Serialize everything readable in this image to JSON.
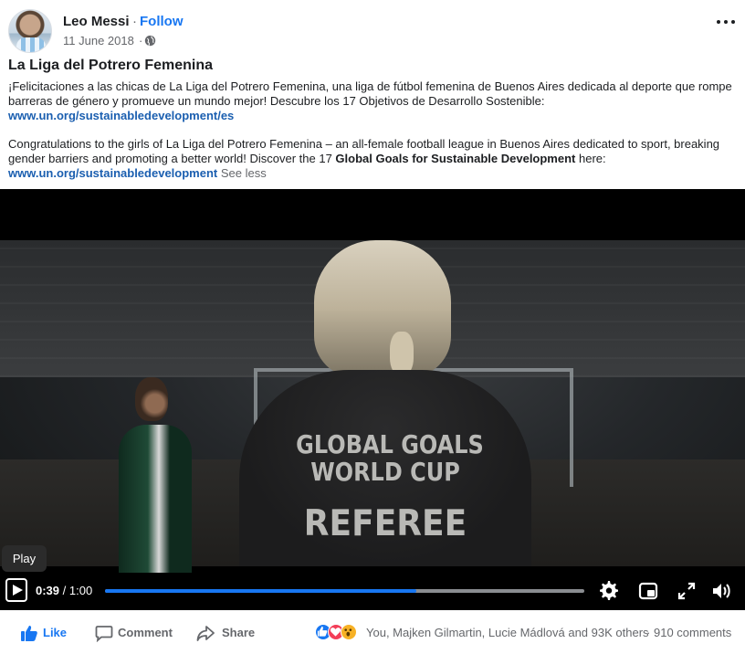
{
  "post": {
    "author": "Leo Messi",
    "separator": "·",
    "follow_label": "Follow",
    "date": "11 June 2018",
    "date_separator": "·",
    "privacy_icon": "globe-icon",
    "more_icon": "more-horizontal-icon",
    "title": "La Liga del Potrero Femenina",
    "para_es_text": "¡Felicitaciones a las chicas de La Liga del Potrero Femenina, una liga de fútbol femenina de Buenos Aires dedicada al deporte que rompe barreras de género y promueve un mundo mejor! Descubre los 17 Objetivos de Desarrollo Sostenible:",
    "para_es_link": "www.un.org/sustainabledevelopment/es",
    "para_en_text_1": "Congratulations to the girls of La Liga del Potrero Femenina – an all-female football league in Buenos Aires dedicated to sport, breaking gender barriers and promoting a better world! Discover the 17 ",
    "para_en_bold": "Global Goals for Sustainable Development",
    "para_en_text_2": " here:",
    "para_en_link": "www.un.org/sustainabledevelopment",
    "see_less": "See less"
  },
  "video": {
    "shirt_line_1": "GLOBAL GOALS",
    "shirt_line_2": "WORLD CUP",
    "shirt_line_3": "REFEREE",
    "tooltip": "Play",
    "current_time": "0:39",
    "time_separator": "/",
    "duration": "1:00",
    "progress_fraction": 0.65,
    "icons": [
      "play-icon",
      "settings-icon",
      "picture-in-picture-icon",
      "fullscreen-icon",
      "volume-icon"
    ]
  },
  "actions": {
    "like_label": "Like",
    "comment_label": "Comment",
    "share_label": "Share",
    "reaction_icons": [
      "like-reaction-icon",
      "love-reaction-icon",
      "wow-reaction-icon"
    ],
    "reaction_names": "You, Majken Gilmartin, Lucie Mádlová and 93K others",
    "dot": "·",
    "comments_count": "910 comments"
  },
  "colors": {
    "accent": "#1877f2",
    "link": "#1b5fb0",
    "secondary_text": "#65676b"
  }
}
